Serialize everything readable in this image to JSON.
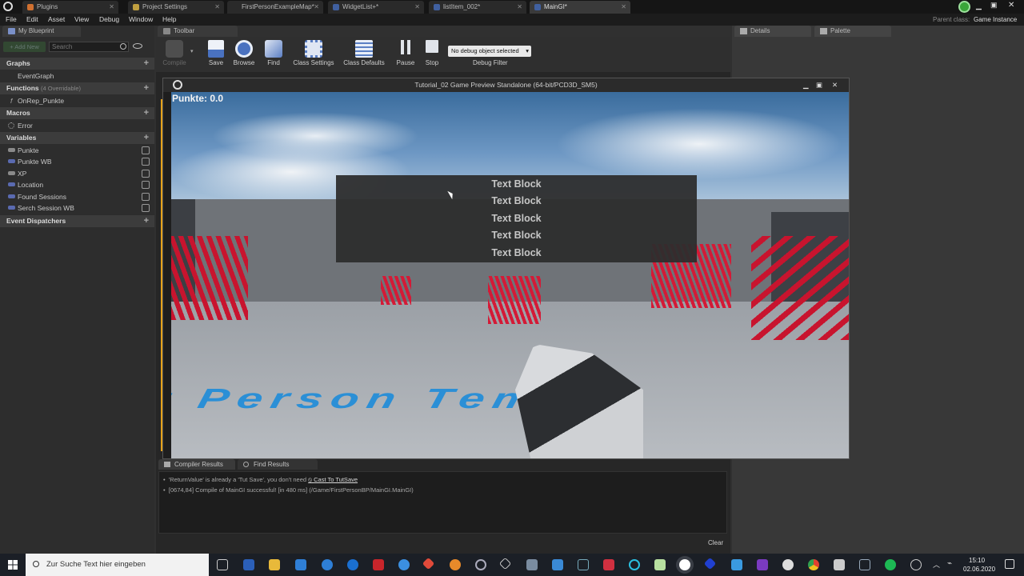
{
  "window": {
    "parent_class_label": "Parent class:",
    "parent_class_value": "Game Instance"
  },
  "doc_tabs": [
    {
      "label": "Plugins",
      "color": "#d07030"
    },
    {
      "label": "Project Settings",
      "color": "#c0a040"
    },
    {
      "label": "FirstPersonExampleMap*",
      "color": "#888888"
    },
    {
      "label": "WidgetList+*",
      "color": "#4060a0"
    },
    {
      "label": "listItem_002*",
      "color": "#4060a0"
    },
    {
      "label": "MainGI*",
      "color": "#4060a0"
    }
  ],
  "menu": [
    "File",
    "Edit",
    "Asset",
    "View",
    "Debug",
    "Window",
    "Help"
  ],
  "left": {
    "tab": "My Blueprint",
    "search_placeholder": "Search",
    "add_new": "+ Add New",
    "graphs_header": "Graphs",
    "graphs": [
      "EventGraph"
    ],
    "functions_header": "Functions",
    "functions_note": "(4 Overridable)",
    "functions": [
      "OnRep_Punkte"
    ],
    "macros_header": "Macros",
    "macros": [
      "Error"
    ],
    "variables_header": "Variables",
    "variables": [
      {
        "label": "Punkte",
        "color": "#8a8a8a"
      },
      {
        "label": "Punkte WB",
        "color": "#5a6ab0"
      },
      {
        "label": "XP",
        "color": "#8a8a8a"
      },
      {
        "label": "Location",
        "color": "#5a6ab0"
      },
      {
        "label": "Found Sessions",
        "color": "#5a6ab0"
      },
      {
        "label": "Serch Session WB",
        "color": "#5a6ab0"
      }
    ],
    "dispatchers_header": "Event Dispatchers"
  },
  "toolbar": {
    "tab": "Toolbar",
    "compile": "Compile",
    "save": "Save",
    "browse": "Browse",
    "find": "Find",
    "class_settings": "Class Settings",
    "class_defaults": "Class Defaults",
    "pause": "Pause",
    "stop": "Stop",
    "debug_select": "No debug object selected",
    "debug_filter": "Debug Filter"
  },
  "right": {
    "details_tab": "Details",
    "palette_tab": "Palette"
  },
  "game": {
    "title": "Tutorial_02 Game Preview Standalone (64-bit/PCD3D_SM5)",
    "score": "Punkte: 0.0",
    "text_blocks": [
      "Text Block",
      "Text Block",
      "Text Block",
      "Text Block",
      "Text Block"
    ],
    "floor_text": "r Person Tem"
  },
  "bottom": {
    "compiler_tab": "Compiler Results",
    "find_tab": "Find Results",
    "msg1": "'ReturnValue' is already a 'Tut Save', you don't need",
    "msg1_link": "Cast To TutSave",
    "msg2": "[0674,84] Compile of MainGI successful! [in 480 ms] (/Game/FirstPersonBP/MainGI.MainGI)",
    "clear": "Clear"
  },
  "taskbar": {
    "search_placeholder": "Zur Suche Text hier eingeben",
    "time": "15:10",
    "date": "02.06.2020"
  }
}
